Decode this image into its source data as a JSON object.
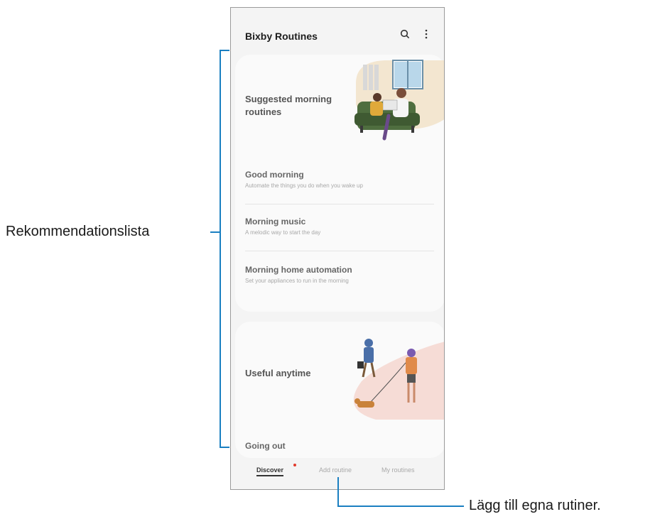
{
  "app": {
    "title": "Bixby Routines",
    "icons": {
      "search": "search-icon",
      "more": "more-options-icon"
    }
  },
  "card1": {
    "heading": "Suggested morning routines",
    "items": [
      {
        "title": "Good morning",
        "subtitle": "Automate the things you do when you wake up"
      },
      {
        "title": "Morning music",
        "subtitle": "A melodic way to start the day"
      },
      {
        "title": "Morning home automation",
        "subtitle": "Set your appliances to run in the morning"
      }
    ]
  },
  "card2": {
    "heading": "Useful anytime",
    "items": [
      {
        "title": "Going out"
      }
    ]
  },
  "tabs": [
    {
      "label": "Discover",
      "active": true
    },
    {
      "label": "Add routine",
      "active": false
    },
    {
      "label": "My routines",
      "active": false
    }
  ],
  "annotations": {
    "left": "Rekommendationslista",
    "bottom": "Lägg till egna rutiner."
  },
  "colors": {
    "accent_line": "#1a7fc1",
    "notification_dot": "#e23a2c",
    "card_bg": "#fafafa",
    "illustration_peach": "#f3e6d0",
    "illustration_pink": "#f6dcd6"
  }
}
